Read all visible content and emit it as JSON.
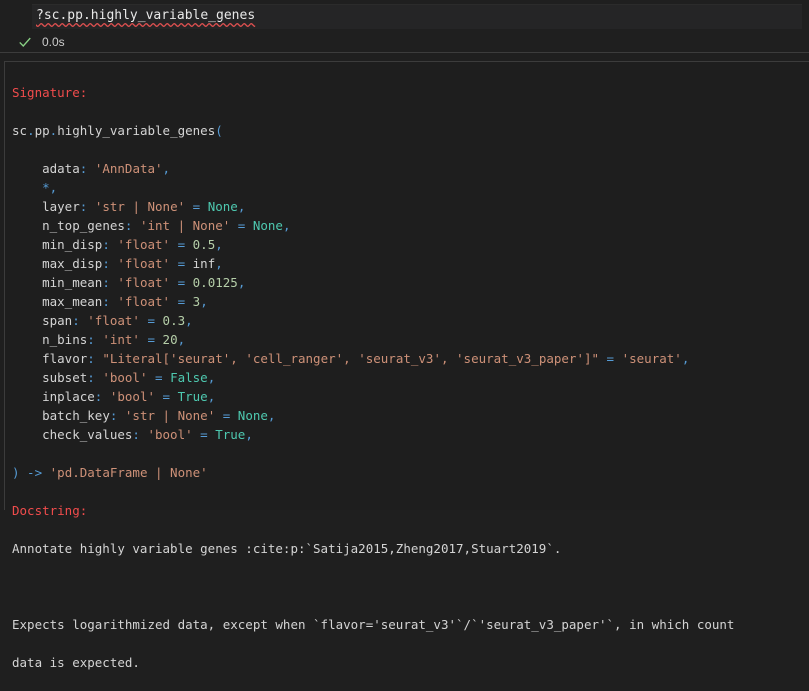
{
  "cell": {
    "code": "?sc.pp.highly_variable_genes",
    "exec_time": "0.0s"
  },
  "output": {
    "signature_label": "Signature:",
    "func_module1": "sc",
    "func_module2": "pp",
    "func_name": "highly_variable_genes",
    "params": [
      {
        "name": "adata",
        "type": "'AnnData'",
        "default": ""
      },
      {
        "name": "*",
        "type": "",
        "default": ""
      },
      {
        "name": "layer",
        "type": "'str | None'",
        "default": "None"
      },
      {
        "name": "n_top_genes",
        "type": "'int | None'",
        "default": "None"
      },
      {
        "name": "min_disp",
        "type": "'float'",
        "default": "0.5"
      },
      {
        "name": "max_disp",
        "type": "'float'",
        "default": "inf"
      },
      {
        "name": "min_mean",
        "type": "'float'",
        "default": "0.0125"
      },
      {
        "name": "max_mean",
        "type": "'float'",
        "default": "3"
      },
      {
        "name": "span",
        "type": "'float'",
        "default": "0.3"
      },
      {
        "name": "n_bins",
        "type": "'int'",
        "default": "20"
      },
      {
        "name": "flavor",
        "type": "\"Literal['seurat', 'cell_ranger', 'seurat_v3', 'seurat_v3_paper']\"",
        "default": "'seurat'"
      },
      {
        "name": "subset",
        "type": "'bool'",
        "default": "False"
      },
      {
        "name": "inplace",
        "type": "'bool'",
        "default": "True"
      },
      {
        "name": "batch_key",
        "type": "'str | None'",
        "default": "None"
      },
      {
        "name": "check_values",
        "type": "'bool'",
        "default": "True"
      }
    ],
    "return_prefix": ") -> ",
    "return_type": "'pd.DataFrame | None'",
    "docstring_label": "Docstring:",
    "doc_line1": "Annotate highly variable genes :cite:p:`Satija2015,Zheng2017,Stuart2019`.",
    "doc_line2": "",
    "doc_line3": "Expects logarithmized data, except when `flavor='seurat_v3'`/`'seurat_v3_paper'`, in which count",
    "doc_line4": "data is expected."
  },
  "colors": {
    "background": "#1f1f1f",
    "error_red": "#f14c4c",
    "string": "#ce9178",
    "keyword": "#569cd6",
    "constant": "#4ec9b0",
    "check_green": "#89d185"
  },
  "icons": {
    "check": "check-icon"
  }
}
